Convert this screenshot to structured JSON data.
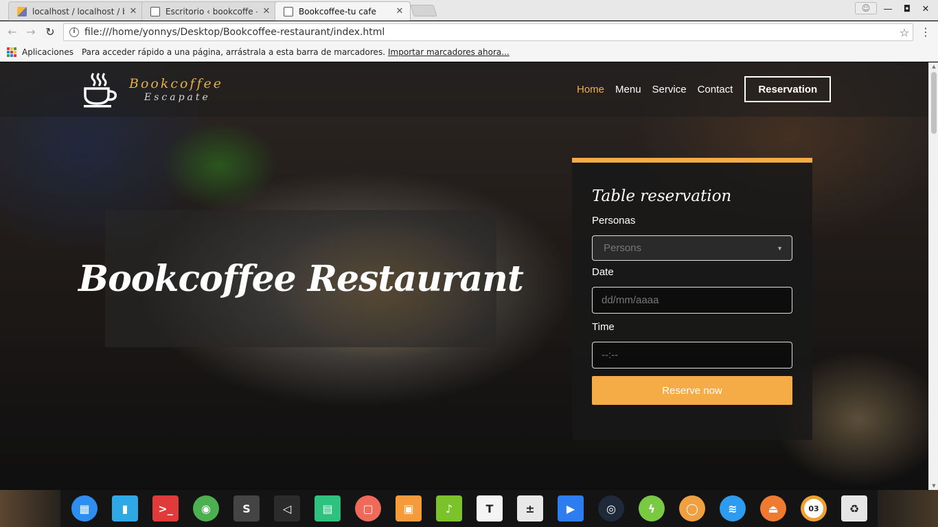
{
  "browser": {
    "tabs": [
      {
        "label": "localhost / localhost / bi",
        "favicon": "phpmyadmin-icon",
        "active": false
      },
      {
        "label": "Escritorio ‹ bookcoffe — ",
        "favicon": "document-icon",
        "active": false
      },
      {
        "label": "Bookcoffee-tu cafe",
        "favicon": "document-icon",
        "active": true
      }
    ],
    "url": "file:///home/yonnys/Desktop/Bookcoffee-restaurant/index.html",
    "bookmarks": {
      "apps_label": "Aplicaciones",
      "hint": "Para acceder rápido a una página, arrástrala a esta barra de marcadores.",
      "import_link": "Importar marcadores ahora..."
    }
  },
  "site": {
    "logo": {
      "brand": "Bookcoffee",
      "tagline": "Escapate"
    },
    "nav": [
      "Home",
      "Menu",
      "Service",
      "Contact"
    ],
    "nav_active": "Home",
    "nav_button": "Reservation",
    "hero_title": "Bookcoffee Restaurant",
    "reservation": {
      "title": "Table reservation",
      "persons_label": "Personas",
      "persons_placeholder": "Persons",
      "date_label": "Date",
      "date_placeholder": "dd/mm/aaaa",
      "time_label": "Time",
      "time_placeholder": "--:--",
      "submit": "Reserve now"
    },
    "colors": {
      "accent": "#f5ac46",
      "text": "#ffffff"
    }
  },
  "dock": {
    "apps": [
      {
        "name": "launcher",
        "color": "#2d8ef0",
        "icon": "grid-icon"
      },
      {
        "name": "file-manager",
        "color": "#2fa8e6",
        "icon": "folder-icon"
      },
      {
        "name": "terminal",
        "color": "#e03a3a",
        "icon": "terminal-icon"
      },
      {
        "name": "chrome",
        "color": "#4caf50",
        "icon": "chrome-icon"
      },
      {
        "name": "sublime-text",
        "color": "#444444",
        "icon": "sublime-icon"
      },
      {
        "name": "visual-studio-code",
        "color": "#2b2b2b",
        "icon": "vscode-icon"
      },
      {
        "name": "system-monitor",
        "color": "#2ec27e",
        "icon": "monitor-icon"
      },
      {
        "name": "screenshot",
        "color": "#f06a5a",
        "icon": "screenshot-icon"
      },
      {
        "name": "app-store",
        "color": "#f59b3c",
        "icon": "store-icon"
      },
      {
        "name": "music",
        "color": "#7cc22a",
        "icon": "music-icon"
      },
      {
        "name": "fonts",
        "color": "#f4f4f4",
        "icon": "font-icon"
      },
      {
        "name": "calculator",
        "color": "#e8e8e8",
        "icon": "calculator-icon"
      },
      {
        "name": "video-player",
        "color": "#2d7cf0",
        "icon": "video-icon"
      },
      {
        "name": "screen-recorder",
        "color": "#1e2a3a",
        "icon": "recorder-icon"
      },
      {
        "name": "power-manager",
        "color": "#7ac943",
        "icon": "power-icon"
      },
      {
        "name": "browser",
        "color": "#f0a040",
        "icon": "browser-icon"
      },
      {
        "name": "network",
        "color": "#2d9cf0",
        "icon": "wifi-icon"
      },
      {
        "name": "eject",
        "color": "#f07a30",
        "icon": "eject-icon"
      },
      {
        "name": "clock",
        "color": "#f0a030",
        "icon": "clock-icon"
      },
      {
        "name": "trash",
        "color": "#e6e6e6",
        "icon": "trash-icon"
      }
    ],
    "clock_text": "03"
  }
}
